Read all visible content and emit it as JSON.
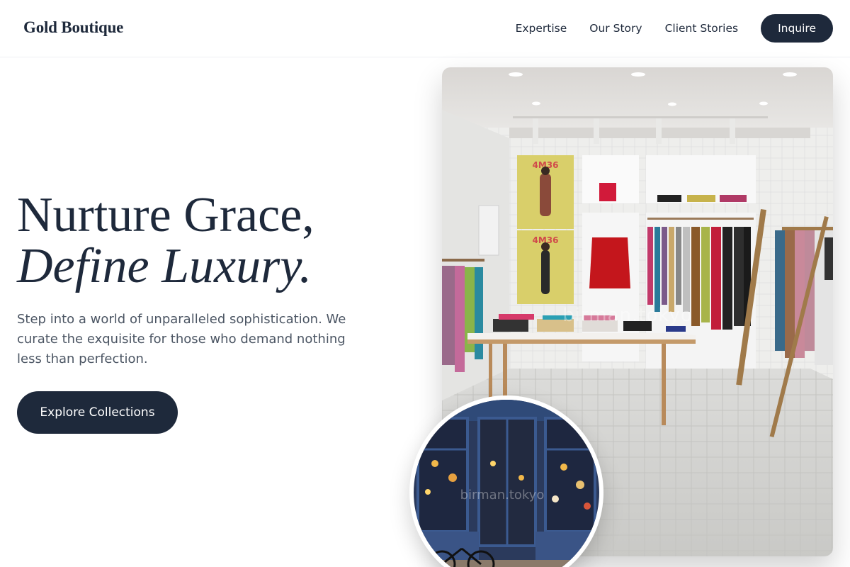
{
  "header": {
    "brand": "Gold Boutique",
    "nav": [
      "Expertise",
      "Our Story",
      "Client Stories"
    ],
    "inquire_label": "Inquire"
  },
  "hero": {
    "title_line1": "Nurture Grace,",
    "title_line2": "Define Luxury.",
    "subtitle": "Step into a world of unparalleled sophistication. We curate the exquisite for those who demand nothing less than perfection.",
    "cta_label": "Explore Collections"
  },
  "images": {
    "store_interior": {
      "watermark": "birman.tokyo",
      "poster_text": "4M36"
    },
    "storefront": {
      "watermark": "birman.tokyo"
    }
  },
  "colors": {
    "primary": "#1e293b",
    "text_muted": "#4b5563",
    "background": "#ffffff"
  }
}
